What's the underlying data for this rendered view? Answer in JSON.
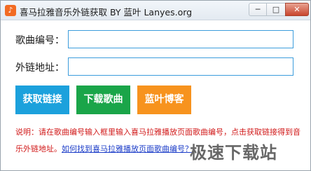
{
  "window": {
    "title": "喜马拉雅音乐外链获取 BY 蓝叶 Lanyes.org",
    "icon": "app-logo-icon",
    "controls": {
      "minimize": "─",
      "maximize": "□",
      "close": "✕"
    }
  },
  "form": {
    "song_id_label": "歌曲编号：",
    "song_id_value": "",
    "link_label": "外链地址：",
    "link_value": ""
  },
  "buttons": {
    "get_link": "获取链接",
    "download": "下载歌曲",
    "blog": "蓝叶博客"
  },
  "description": {
    "text": "说明：请在歌曲编号输入框里输入喜马拉雅播放页面歌曲编号，点击获取链接得到音乐外链地址。",
    "link_text": "如何找到喜马拉雅播放页面歌曲编号？"
  },
  "watermark": "极速下载站",
  "colors": {
    "get_link_bg": "#1ca1dc",
    "download_bg": "#1aa549",
    "blog_bg": "#f7931e",
    "description_text": "#d11a1a",
    "link_text": "#1b3cc8",
    "input_border": "#3c9ddc"
  }
}
